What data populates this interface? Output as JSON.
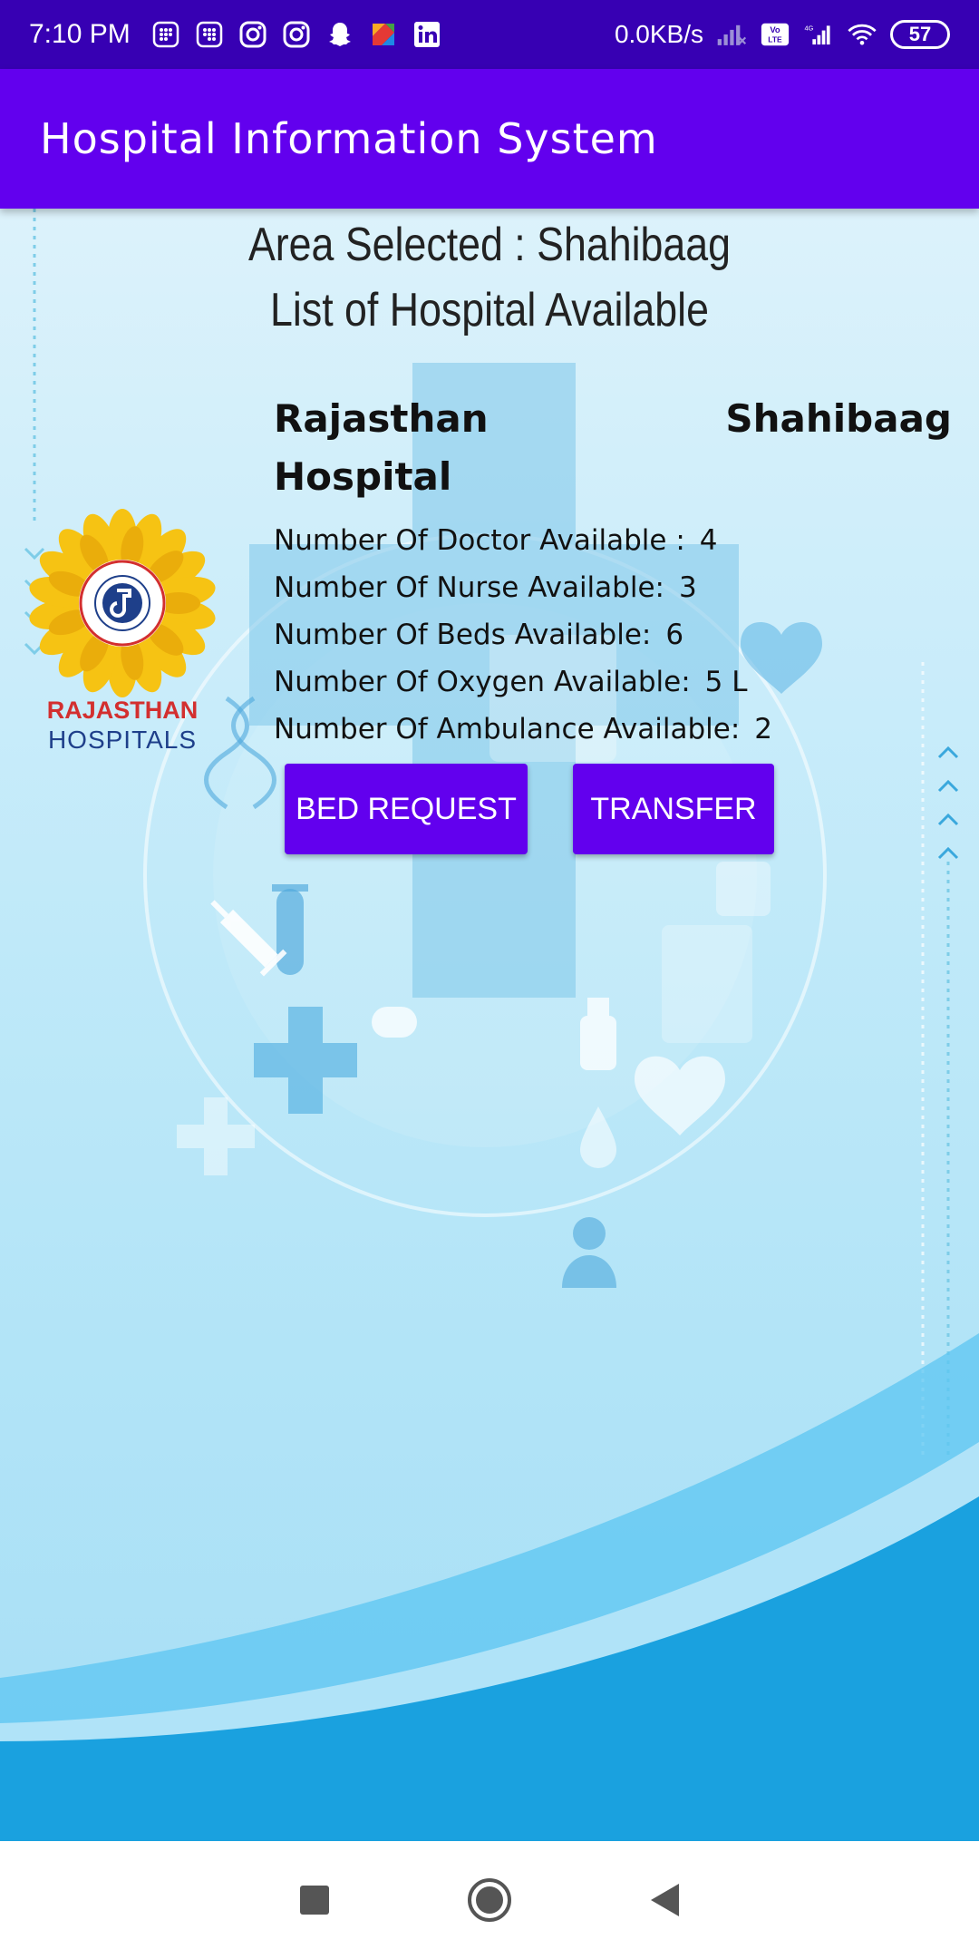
{
  "status_bar": {
    "time": "7:10 PM",
    "network_speed": "0.0KB/s",
    "volte": "Vo LTE",
    "network_type": "4G",
    "battery": "57",
    "icons": [
      "grid-app-icon",
      "grid-app-icon",
      "instagram-icon",
      "instagram-icon",
      "snapchat-icon",
      "colorful-app-icon",
      "linkedin-icon",
      "signal-icon",
      "wifi-icon",
      "battery-icon"
    ]
  },
  "app_bar": {
    "title": "Hospital Information System",
    "color": "#6200ee"
  },
  "header": {
    "area_selected": "Area Selected : Shahibaag",
    "list_title": "List of Hospital Available"
  },
  "hospital": {
    "logo_text_line1": "RAJASTHAN",
    "logo_text_line2": "HOSPITALS",
    "name": "Rajasthan Hospital",
    "area": "Shahibaag",
    "stats": [
      {
        "label": "Number Of Doctor Available :",
        "value": "4"
      },
      {
        "label": "Number Of Nurse Available:",
        "value": "3"
      },
      {
        "label": "Number Of Beds Available:",
        "value": "6"
      },
      {
        "label": "Number Of Oxygen Available:",
        "value": "5 L"
      },
      {
        "label": "Number Of Ambulance Available:",
        "value": "2"
      }
    ]
  },
  "buttons": {
    "bed_request": "BED REQUEST",
    "transfer": "TRANSFER"
  },
  "nav_bar": {
    "icons": [
      "recent-apps-icon",
      "home-icon",
      "back-icon"
    ]
  },
  "colors": {
    "status_bar": "#3700b3",
    "primary": "#6200ee",
    "background_light": "#dcf2fb",
    "wave": "#1aa1df"
  }
}
